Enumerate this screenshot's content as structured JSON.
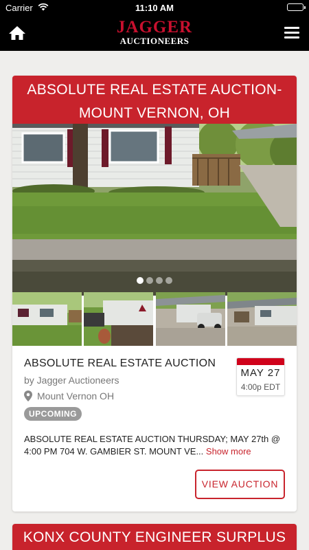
{
  "status_bar": {
    "carrier": "Carrier",
    "time": "11:10 AM"
  },
  "header": {
    "logo_line1": "JAGGER",
    "logo_line2": "AUCTIONEERS"
  },
  "auctions": [
    {
      "title": "ABSOLUTE REAL ESTATE AUCTION- MOUNT VERNON, OH",
      "name": "ABSOLUTE REAL ESTATE AUCTION",
      "by": "by Jagger Auctioneers",
      "location": "Mount Vernon OH",
      "status": "UPCOMING",
      "date": "MAY 27",
      "time": "4:00p EDT",
      "description": "ABSOLUTE REAL ESTATE AUCTION THURSDAY; MAY 27th @ 4:00 PM 704 W. GAMBIER ST. MOUNT VE...",
      "show_more": "Show more",
      "view_button": "VIEW AUCTION",
      "carousel_active_index": 0,
      "carousel_count": 4
    },
    {
      "title": "KONX COUNTY ENGINEER SURPLUS"
    }
  ],
  "colors": {
    "accent": "#c8232c",
    "header_bg": "#000000",
    "page_bg": "#efeeec"
  }
}
